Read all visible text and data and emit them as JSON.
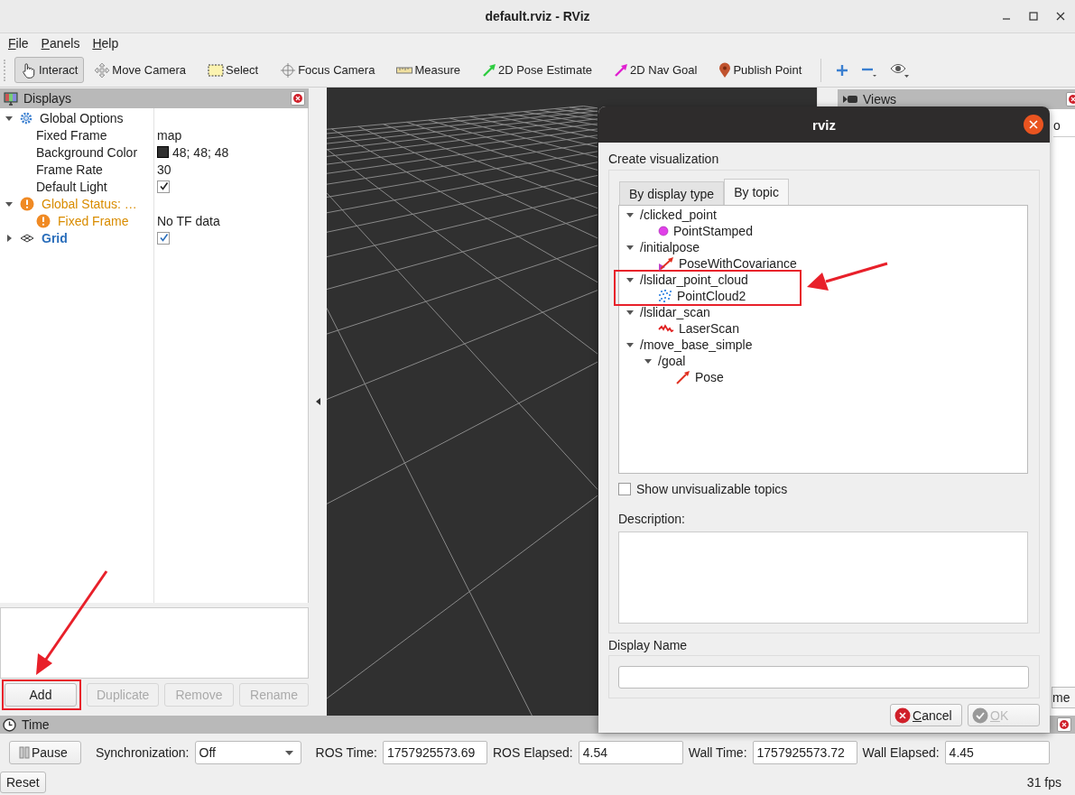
{
  "window": {
    "title": "default.rviz - RViz"
  },
  "menu": [
    {
      "label": "File"
    },
    {
      "label": "Panels"
    },
    {
      "label": "Help"
    }
  ],
  "toolbar": [
    {
      "kind": "interact",
      "label": "Interact",
      "selected": true
    },
    {
      "kind": "move-camera",
      "label": "Move Camera",
      "selected": false
    },
    {
      "kind": "select",
      "label": "Select",
      "selected": false
    },
    {
      "kind": "focus-camera",
      "label": "Focus Camera",
      "selected": false
    },
    {
      "kind": "measure",
      "label": "Measure",
      "selected": false
    },
    {
      "kind": "pose-estimate",
      "label": "2D Pose Estimate",
      "selected": false
    },
    {
      "kind": "nav-goal",
      "label": "2D Nav Goal",
      "selected": false
    },
    {
      "kind": "publish-point",
      "label": "Publish Point",
      "selected": false
    }
  ],
  "toolbar_actions": [
    {
      "kind": "add"
    },
    {
      "kind": "remove"
    },
    {
      "kind": "view"
    }
  ],
  "displays": {
    "title": "Displays",
    "tree": [
      {
        "label": "Global Options",
        "kind": "options",
        "expanded": true,
        "children": [
          {
            "label": "Fixed Frame",
            "value": "map"
          },
          {
            "label": "Background Color",
            "value": "48; 48; 48",
            "color": "#303030"
          },
          {
            "label": "Frame Rate",
            "value": "30"
          },
          {
            "label": "Default Light",
            "checked": true
          }
        ]
      },
      {
        "label": "Global Status: …",
        "kind": "warning",
        "expanded": true,
        "children": [
          {
            "label": "Fixed Frame",
            "kind": "warning",
            "value": "No TF data"
          }
        ]
      },
      {
        "label": "Grid",
        "kind": "display",
        "expanded": false,
        "checked": true
      }
    ],
    "buttons": [
      {
        "label": "Add",
        "disabled": false,
        "highlighted": true
      },
      {
        "label": "Duplicate",
        "disabled": true,
        "highlighted": false
      },
      {
        "label": "Remove",
        "disabled": true,
        "highlighted": false
      },
      {
        "label": "Rename",
        "disabled": true,
        "highlighted": false
      }
    ]
  },
  "views": {
    "title": "Views",
    "field": "o",
    "button": "me"
  },
  "time": {
    "title": "Time",
    "pause": "Pause",
    "sync_label": "Synchronization:",
    "sync_value": "Off",
    "fields": [
      {
        "label": "ROS Time:",
        "value": "1757925573.69"
      },
      {
        "label": "ROS Elapsed:",
        "value": "4.54"
      },
      {
        "label": "Wall Time:",
        "value": "1757925573.72"
      },
      {
        "label": "Wall Elapsed:",
        "value": "4.45"
      }
    ],
    "reset": "Reset",
    "fps": "31 fps"
  },
  "dialog": {
    "title": "rviz",
    "heading": "Create visualization",
    "tabs": [
      {
        "label": "By display type",
        "selected": false
      },
      {
        "label": "By topic",
        "selected": true
      }
    ],
    "topics": [
      {
        "label": "/clicked_point",
        "expanded": true,
        "highlighted": false,
        "children": [
          {
            "label": "PointStamped",
            "kind": "point"
          }
        ]
      },
      {
        "label": "/initialpose",
        "expanded": true,
        "highlighted": false,
        "children": [
          {
            "label": "PoseWithCovariance",
            "kind": "pose-covariance"
          }
        ]
      },
      {
        "label": "/lslidar_point_cloud",
        "expanded": true,
        "highlighted": true,
        "children": [
          {
            "label": "PointCloud2",
            "kind": "point-cloud"
          }
        ]
      },
      {
        "label": "/lslidar_scan",
        "expanded": true,
        "highlighted": false,
        "children": [
          {
            "label": "LaserScan",
            "kind": "laser-scan"
          }
        ]
      },
      {
        "label": "/move_base_simple",
        "expanded": true,
        "highlighted": false,
        "children": [
          {
            "label": "/goal",
            "expanded": true,
            "highlighted": false,
            "children": [
              {
                "label": "Pose",
                "kind": "pose"
              }
            ]
          }
        ]
      }
    ],
    "show_unvisualizable": {
      "label": "Show unvisualizable topics",
      "checked": false
    },
    "description_label": "Description:",
    "display_name_label": "Display Name",
    "buttons": [
      {
        "kind": "cancel",
        "label": "Cancel",
        "disabled": false
      },
      {
        "kind": "ok",
        "label": "OK",
        "disabled": true
      }
    ]
  }
}
